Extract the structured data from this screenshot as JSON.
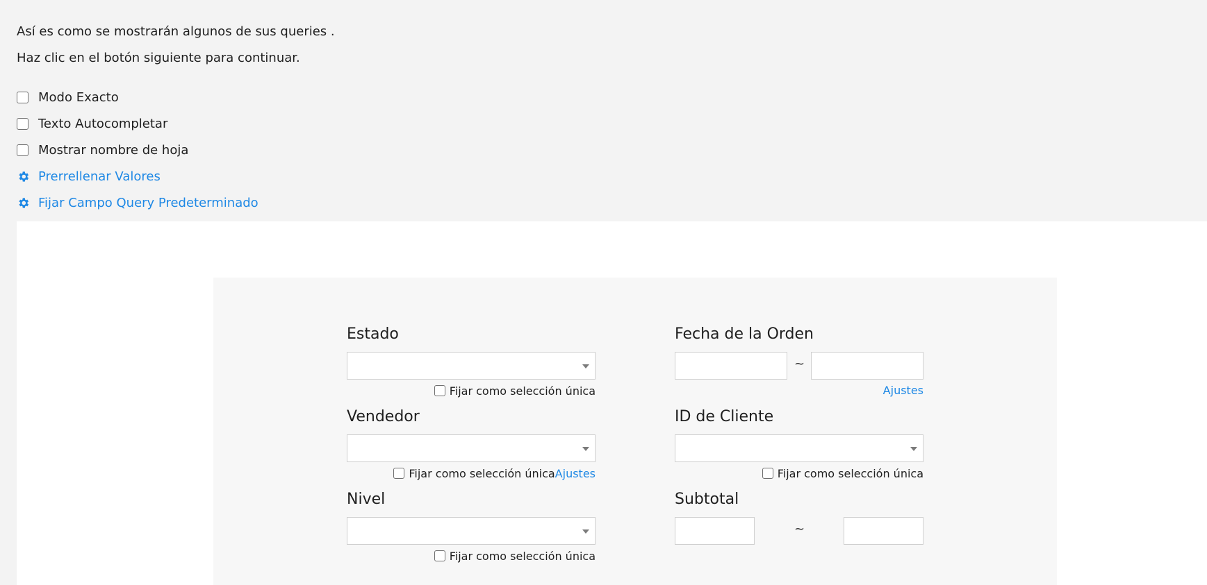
{
  "intro": {
    "line1": "Así es como se mostrarán algunos de sus queries .",
    "line2": "Haz clic en el botón siguiente para continuar."
  },
  "options": {
    "exact_mode": "Modo Exacto",
    "autocomplete": "Texto Autocompletar",
    "show_sheet_name": "Mostrar nombre de hoja",
    "prefill_values": "Prerrellenar Valores",
    "default_query_field": "Fijar Campo Query Predeterminado"
  },
  "form": {
    "estado": {
      "label": "Estado",
      "single_select": "Fijar como selección única"
    },
    "fecha": {
      "label": "Fecha de la Orden",
      "separator": "~",
      "settings": "Ajustes"
    },
    "vendedor": {
      "label": "Vendedor",
      "single_select": "Fijar como selección única",
      "settings": "Ajustes"
    },
    "cliente": {
      "label": "ID de Cliente",
      "single_select": "Fijar como selección única"
    },
    "nivel": {
      "label": "Nivel",
      "single_select": "Fijar como selección única"
    },
    "subtotal": {
      "label": "Subtotal",
      "separator": "~"
    }
  },
  "colors": {
    "page_bg": "#f3f3f3",
    "panel_bg": "#f7f7f7",
    "link": "#1e88e5",
    "border": "#cfcfcf"
  }
}
